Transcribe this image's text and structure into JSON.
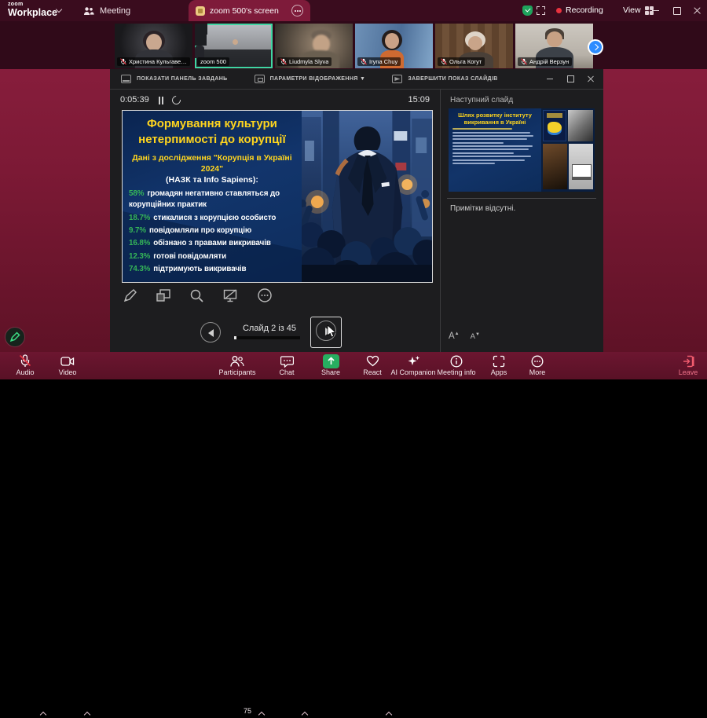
{
  "titlebar": {
    "brand_top": "zoom",
    "brand_bottom": "Workplace",
    "meeting_tab": "Meeting",
    "screen_tab": "zoom 500's screen",
    "recording_label": "Recording",
    "view_label": "View"
  },
  "video_strip": {
    "participants": [
      {
        "name": "Христина Кульгавець",
        "muted": true
      },
      {
        "name": "zoom 500",
        "muted": false,
        "active_speaker": true
      },
      {
        "name": "Liudmyla Slyva",
        "muted": true
      },
      {
        "name": "Iryna Chuy",
        "muted": true
      },
      {
        "name": "Ольга Когут",
        "muted": true
      },
      {
        "name": "Андрій Верзун",
        "muted": true
      }
    ]
  },
  "presenter_view": {
    "menu_show_taskbar": "ПОКАЗАТИ ПАНЕЛЬ ЗАВДАНЬ",
    "menu_display_settings": "ПАРАМЕТРИ ВІДОБРАЖЕННЯ ▼",
    "menu_end_show": "ЗАВЕРШИТИ ПОКАЗ СЛАЙДІВ",
    "elapsed_time": "0:05:39",
    "clock": "15:09",
    "next_slide_header": "Наступний слайд",
    "notes_placeholder": "Примітки відсутні.",
    "slide_position": "Слайд 2 із 45",
    "font_larger": "A",
    "font_smaller": "A"
  },
  "slide": {
    "title": "Формування культури нетерпимості до корупції",
    "subtitle": "Дані з дослідження \"Корупція в Україні 2024\"",
    "org_line": "(НАЗК та Info Sapiens):",
    "stats": [
      {
        "value": "58%",
        "text": "громадян негативно ставляться до корупційних практик"
      },
      {
        "value": "18.7%",
        "text": "стикалися з корупцією особисто"
      },
      {
        "value": "9.7%",
        "text": "повідомляли про корупцію"
      },
      {
        "value": "16.8%",
        "text": "обізнано з правами викривачів"
      },
      {
        "value": "12.3%",
        "text": "готові повідомляти"
      },
      {
        "value": "74.3%",
        "text": "підтримують викривачів"
      }
    ]
  },
  "next_slide": {
    "title": "Шлях розвитку інституту викривання в Україні"
  },
  "toolbar": {
    "audio": "Audio",
    "video": "Video",
    "participants": "Participants",
    "participants_count": "75",
    "chat": "Chat",
    "share": "Share",
    "react": "React",
    "ai_companion": "AI Companion",
    "meeting_info": "Meeting info",
    "apps": "Apps",
    "more": "More",
    "leave": "Leave"
  },
  "colors": {
    "share_green": "#27ae60",
    "record_red": "#e8323f",
    "active_speaker_green": "#3fd6a3",
    "slide_title_yellow": "#ffd51e",
    "stat_green": "#35b558"
  }
}
